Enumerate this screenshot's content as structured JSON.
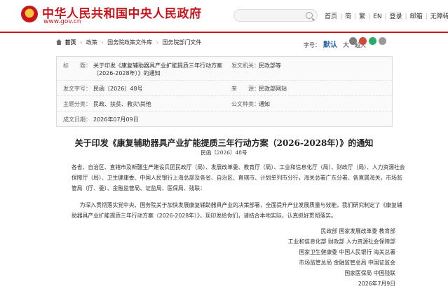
{
  "header": {
    "site_title": "中华人民共和国中央人民政府",
    "site_url": "www.gov.cn",
    "search_placeholder": "",
    "nav": [
      "首页",
      "简",
      "繁",
      "EN",
      "登录",
      "邮箱",
      "无障碍"
    ]
  },
  "breadcrumb": {
    "items": [
      "首页",
      "政策",
      "国务院政策文件库",
      "国务院部门文件"
    ],
    "font_size_label": "字号：",
    "font_sizes": [
      "默认",
      "大",
      "超大"
    ]
  },
  "meta": {
    "title_label": "标　　题：",
    "title_value_line1": "关于印发《康复辅助器具产业扩能提质三年行动方案（2026-2028年）》的通知",
    "title_value_line2": "",
    "issuer_label": "发文机关：",
    "issuer_value": "民政部等",
    "doc_no_label": "发文字号：",
    "doc_no_value": "民函〔2026〕48号",
    "source_label": "来　　源：",
    "source_value": "民政部网站",
    "category_label": "主题分类：",
    "category_value": "民政、扶贫、救灾\\其他",
    "type_label": "公文种类：",
    "type_value": "通知",
    "date_label": "成文日期：",
    "date_value": "2026年07月09日"
  },
  "document": {
    "title": "关于印发《康复辅助器具产业扩能提质三年行动方案（2026-2028年）》的通知",
    "number": "民函〔2026〕48号",
    "recipients": "各省、自治区、直辖市及新疆生产建设兵团民政厅（局）、发展改革委、教育厅（局）、工业和信息化厅（局）、财政厅（局）、人力资源社会保障厅（局）、卫生健康委、中国人民银行上海总部及各省、自治区、直辖市、计划单列市分行，海关总署广东分署、各直属海关，市场监管局（厅、委）、金融监管局、证监局、医保局、残联：",
    "body": "为深入贯彻落实党中央、国务院关于加快发展康复辅助器具产业的决策部署，全面提升产业发展质量与效能，我们研究制定了《康复辅助器具产业扩能提质三年行动方案（2026-2028年）》，现印发给你们，请结合本地实际，认真抓好贯彻落实。",
    "signers": [
      "民政部  国家发展改革委  教育部",
      "工业和信息化部  财政部  人力资源社会保障部",
      "国家卫生健康委  中国人民银行  海关总署",
      "市场监管总局  金融监管总局  中国证监会",
      "国家医保局  中国残联"
    ],
    "date": "2026年7月9日"
  }
}
